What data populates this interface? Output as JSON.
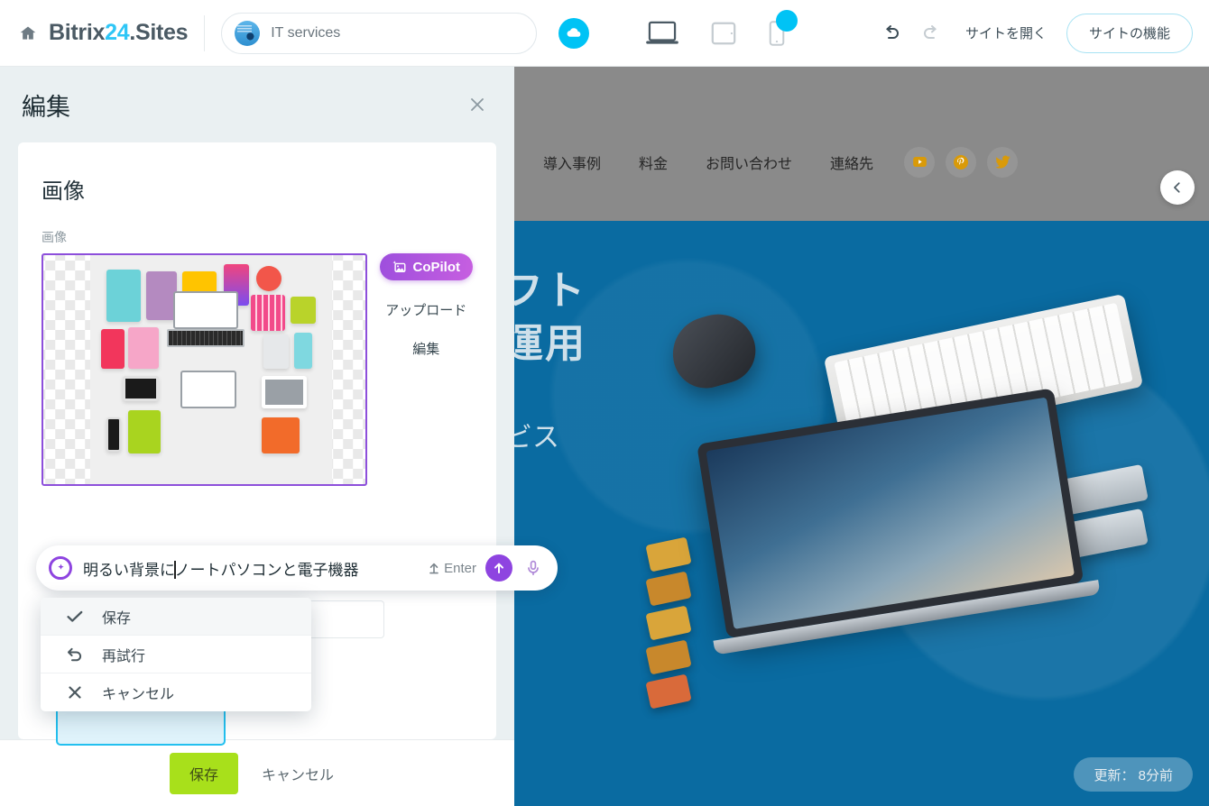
{
  "topbar": {
    "home_icon": "home-icon",
    "brand_prefix": "Bitrix",
    "brand_accent": "24",
    "brand_suffix": ".Sites",
    "search_value": "IT services",
    "cloud_icon": "cloud-icon",
    "devices": [
      {
        "name": "desktop-view",
        "icon": "laptop-icon",
        "active": true
      },
      {
        "name": "tablet-view",
        "icon": "tablet-icon",
        "active": false
      },
      {
        "name": "mobile-view",
        "icon": "phone-icon",
        "active": false,
        "badge": true
      }
    ],
    "undo_icon": "undo-icon",
    "redo_icon": "redo-icon",
    "open_site_label": "サイトを開く",
    "site_features_label": "サイトの機能"
  },
  "panel": {
    "title": "編集",
    "close_icon": "close-icon",
    "section_title": "画像",
    "image_field_label": "画像",
    "copilot_label": "CoPilot",
    "copilot_icon": "image-sparkle-icon",
    "upload_label": "アップロード",
    "edit_label": "編集",
    "prompt": {
      "ai_icon": "copilot-circle-icon",
      "text_before_caret": "明るい背景に",
      "text_after_caret": "ノートパソコンと電子機器",
      "enter_key_icon": "enter-key-icon",
      "enter_label": "Enter",
      "send_icon": "arrow-up-icon",
      "mic_icon": "microphone-icon"
    },
    "dropdown": [
      {
        "label": "保存",
        "icon": "check-icon",
        "selected": true
      },
      {
        "label": "再試行",
        "icon": "retry-arrow-icon",
        "selected": false
      },
      {
        "label": "キャンセル",
        "icon": "x-icon",
        "selected": false
      }
    ],
    "footer": {
      "save_label": "保存",
      "cancel_label": "キャンセル"
    }
  },
  "preview": {
    "nav_items": [
      "導入事例",
      "料金",
      "お問い合わせ",
      "連絡先"
    ],
    "socials": [
      "youtube-icon",
      "pinterest-icon",
      "twitter-icon"
    ],
    "collapse_icon": "chevron-left-icon",
    "hero_title": "フト\n運用",
    "hero_sub": "ビス",
    "updated_label": "更新： 8分前"
  },
  "colors": {
    "brand_accent": "#2fc6f6",
    "copilot_purple": "#8e44e0",
    "save_green": "#a8e01b",
    "hero_blue": "#0a6ba1",
    "cyan": "#00c3f5",
    "image_border": "#8d4fdb"
  }
}
